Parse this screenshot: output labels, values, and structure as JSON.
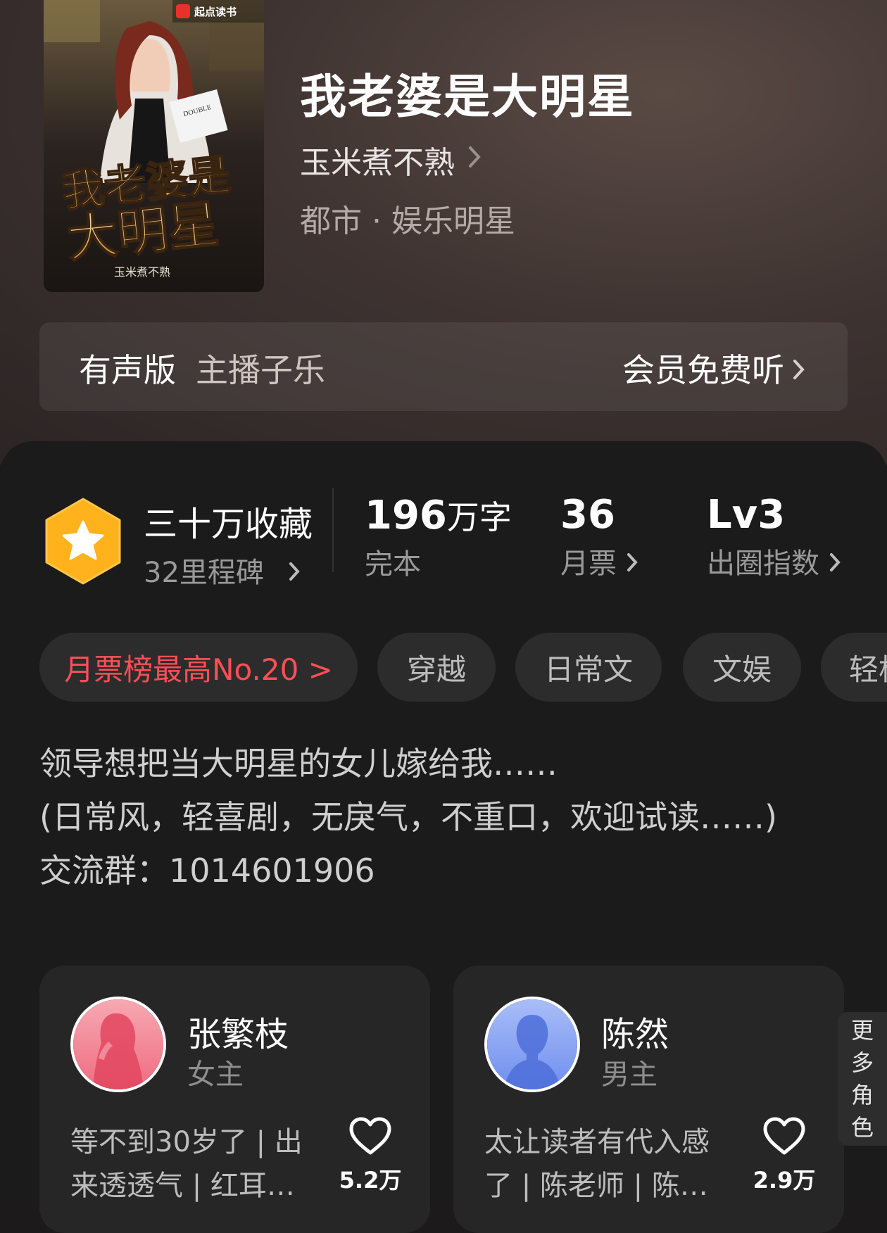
{
  "book": {
    "title": "我老婆是大明星",
    "author": "玉米煮不熟",
    "genre": "都市 · 娱乐明星",
    "cover": {
      "publisher_mark": "起点读书",
      "cover_title_line1": "我老婆是",
      "cover_title_line2": "大明星",
      "cover_author": "玉米煮不熟",
      "cover_doc_text": "DOUBLE"
    }
  },
  "audio": {
    "label": "有声版",
    "host": "主播子乐",
    "action": "会员免费听"
  },
  "stats": {
    "collection": {
      "title": "三十万收藏",
      "subtitle": "32里程碑"
    },
    "words": {
      "value": "196",
      "unit": "万字",
      "label": "完本"
    },
    "monthly_ticket": {
      "value": "36",
      "label": "月票"
    },
    "index": {
      "value": "Lv3",
      "label": "出圈指数"
    }
  },
  "tags": [
    {
      "label": "月票榜最高No.20 >"
    },
    {
      "label": "穿越"
    },
    {
      "label": "日常文"
    },
    {
      "label": "文娱"
    },
    {
      "label": "轻松"
    }
  ],
  "description": {
    "line1": "领导想把当大明星的女儿嫁给我……",
    "line2": "(日常风，轻喜剧，无戾气，不重口，欢迎试读……)",
    "line3": "交流群：1014601906"
  },
  "roles": [
    {
      "name": "张繁枝",
      "type": "女主",
      "desc_line1": "等不到30岁了 | 出",
      "desc_line2": "来透透气 | 红耳…",
      "likes": "5.2万"
    },
    {
      "name": "陈然",
      "type": "男主",
      "desc_line1": "太让读者有代入感",
      "desc_line2": "了 | 陈老师 | 陈…",
      "likes": "2.9万"
    }
  ],
  "more_roles": {
    "chars": [
      "更",
      "多",
      "角",
      "色"
    ]
  },
  "colors": {
    "accent_red": "#ff4f55",
    "badge_orange": "#ffb21c",
    "panel_bg": "#1b1b1b"
  }
}
